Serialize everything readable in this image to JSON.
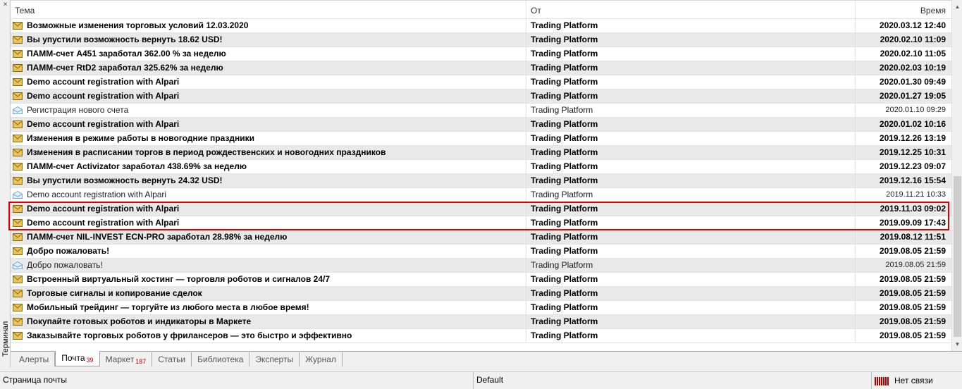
{
  "side": {
    "label": "Терминал",
    "close_glyph": "×"
  },
  "columns": {
    "subject": "Тема",
    "from": "От",
    "time": "Время"
  },
  "messages": [
    {
      "subject": "Возможные изменения торговых условий 12.03.2020",
      "from": "Trading Platform",
      "time": "2020.03.12 12:40",
      "unread": true
    },
    {
      "subject": "Вы упустили возможность вернуть 18.62 USD!",
      "from": "Trading Platform",
      "time": "2020.02.10 11:09",
      "unread": true
    },
    {
      "subject": "ПАММ-счет A451 заработал 362.00 % за неделю",
      "from": "Trading Platform",
      "time": "2020.02.10 11:05",
      "unread": true
    },
    {
      "subject": "ПАММ-счет RtD2 заработал 325.62% за неделю",
      "from": "Trading Platform",
      "time": "2020.02.03 10:19",
      "unread": true
    },
    {
      "subject": "Demo account registration with Alpari",
      "from": "Trading Platform",
      "time": "2020.01.30 09:49",
      "unread": true
    },
    {
      "subject": "Demo account registration with Alpari",
      "from": "Trading Platform",
      "time": "2020.01.27 19:05",
      "unread": true
    },
    {
      "subject": "Регистрация нового счета",
      "from": "Trading Platform",
      "time": "2020.01.10 09:29",
      "unread": false
    },
    {
      "subject": "Demo account registration with Alpari",
      "from": "Trading Platform",
      "time": "2020.01.02 10:16",
      "unread": true
    },
    {
      "subject": "Изменения в режиме работы в новогодние праздники",
      "from": "Trading Platform",
      "time": "2019.12.26 13:19",
      "unread": true
    },
    {
      "subject": "Изменения в расписании торгов в период рождественских и новогодних праздников",
      "from": "Trading Platform",
      "time": "2019.12.25 10:31",
      "unread": true
    },
    {
      "subject": "ПАММ-счет Activizator заработал 438.69% за неделю",
      "from": "Trading Platform",
      "time": "2019.12.23 09:07",
      "unread": true
    },
    {
      "subject": "Вы упустили возможность вернуть 24.32 USD!",
      "from": "Trading Platform",
      "time": "2019.12.16 15:54",
      "unread": true
    },
    {
      "subject": "Demo account registration with Alpari",
      "from": "Trading Platform",
      "time": "2019.11.21 10:33",
      "unread": false
    },
    {
      "subject": "Demo account registration with Alpari",
      "from": "Trading Platform",
      "time": "2019.11.03 09:02",
      "unread": true
    },
    {
      "subject": "Demo account registration with Alpari",
      "from": "Trading Platform",
      "time": "2019.09.09 17:43",
      "unread": true
    },
    {
      "subject": "ПАММ-счет NIL-INVEST ECN-PRO заработал 28.98% за неделю",
      "from": "Trading Platform",
      "time": "2019.08.12 11:51",
      "unread": true
    },
    {
      "subject": "Добро пожаловать!",
      "from": "Trading Platform",
      "time": "2019.08.05 21:59",
      "unread": true
    },
    {
      "subject": "Добро пожаловать!",
      "from": "Trading Platform",
      "time": "2019.08.05 21:59",
      "unread": false
    },
    {
      "subject": "Встроенный виртуальный хостинг — торговля роботов и сигналов 24/7",
      "from": "Trading Platform",
      "time": "2019.08.05 21:59",
      "unread": true
    },
    {
      "subject": "Торговые сигналы и копирование сделок",
      "from": "Trading Platform",
      "time": "2019.08.05 21:59",
      "unread": true
    },
    {
      "subject": "Мобильный трейдинг — торгуйте из любого места в любое время!",
      "from": "Trading Platform",
      "time": "2019.08.05 21:59",
      "unread": true
    },
    {
      "subject": "Покупайте готовых роботов и индикаторы в Маркете",
      "from": "Trading Platform",
      "time": "2019.08.05 21:59",
      "unread": true
    },
    {
      "subject": "Заказывайте торговых роботов у фрилансеров — это быстро и эффективно",
      "from": "Trading Platform",
      "time": "2019.08.05 21:59",
      "unread": true
    }
  ],
  "tabs": [
    {
      "label": "Алерты",
      "badge": "",
      "active": false
    },
    {
      "label": "Почта",
      "badge": "39",
      "active": true
    },
    {
      "label": "Маркет",
      "badge": "187",
      "active": false
    },
    {
      "label": "Статьи",
      "badge": "",
      "active": false
    },
    {
      "label": "Библиотека",
      "badge": "",
      "active": false
    },
    {
      "label": "Эксперты",
      "badge": "",
      "active": false
    },
    {
      "label": "Журнал",
      "badge": "",
      "active": false
    }
  ],
  "status": {
    "left": "Страница почты",
    "profile": "Default",
    "connection": "Нет связи"
  },
  "colors": {
    "unread_icon": "#e8c25a",
    "read_icon": "#6fa8dc",
    "highlight": "#e00000",
    "badge": "#c00000"
  },
  "icons": {
    "unread": "envelope-closed-icon",
    "read": "envelope-open-icon",
    "connection": "connection-bars-icon"
  }
}
